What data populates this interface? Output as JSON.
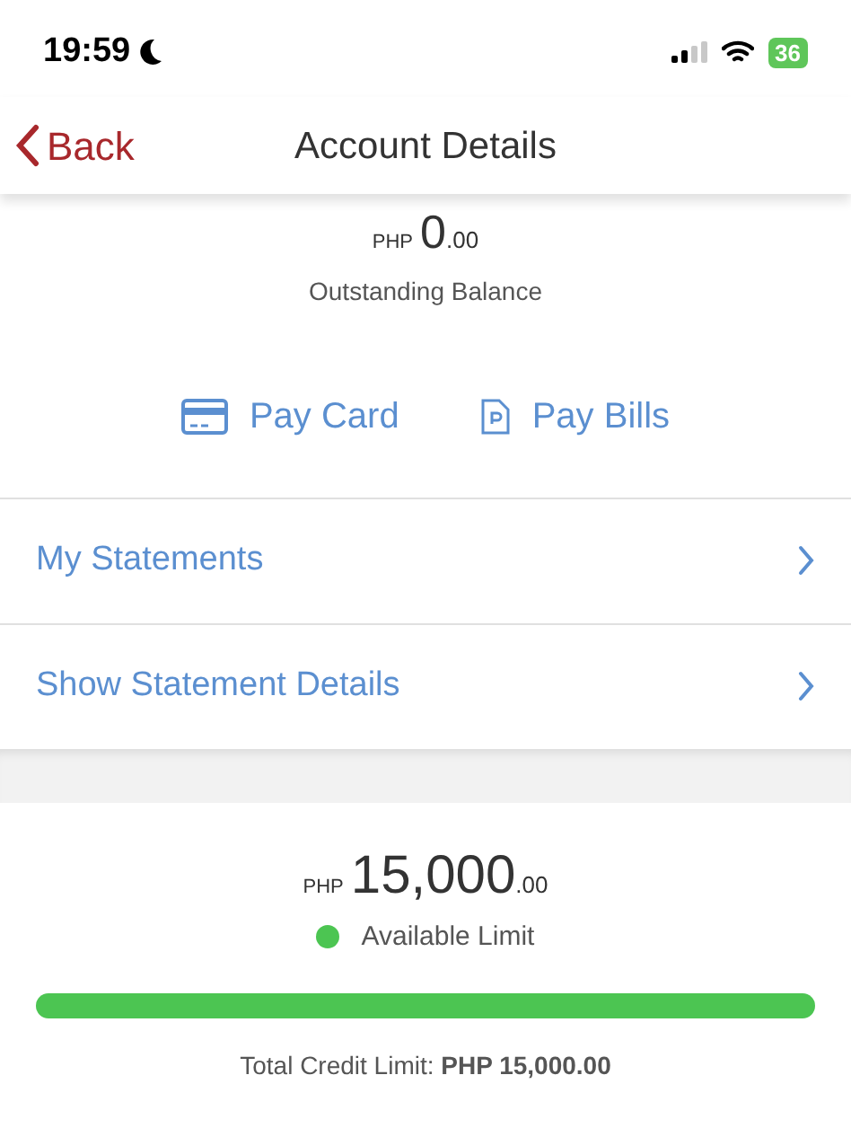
{
  "status_bar": {
    "time": "19:59",
    "battery": "36"
  },
  "nav": {
    "back": "Back",
    "title": "Account Details"
  },
  "balance": {
    "currency": "PHP",
    "whole": "0",
    "cents": ".00",
    "label": "Outstanding Balance"
  },
  "actions": [
    {
      "kind": "card",
      "label": "Pay Card"
    },
    {
      "kind": "bill",
      "label": "Pay Bills"
    }
  ],
  "menu": [
    {
      "label": "My Statements"
    },
    {
      "label": "Show Statement Details"
    }
  ],
  "limit": {
    "currency": "PHP",
    "whole": "15,000",
    "cents": ".00",
    "label": "Available Limit",
    "color": "#4cc552",
    "total": "Total Credit Limit: **PHP 15,000.00**"
  }
}
